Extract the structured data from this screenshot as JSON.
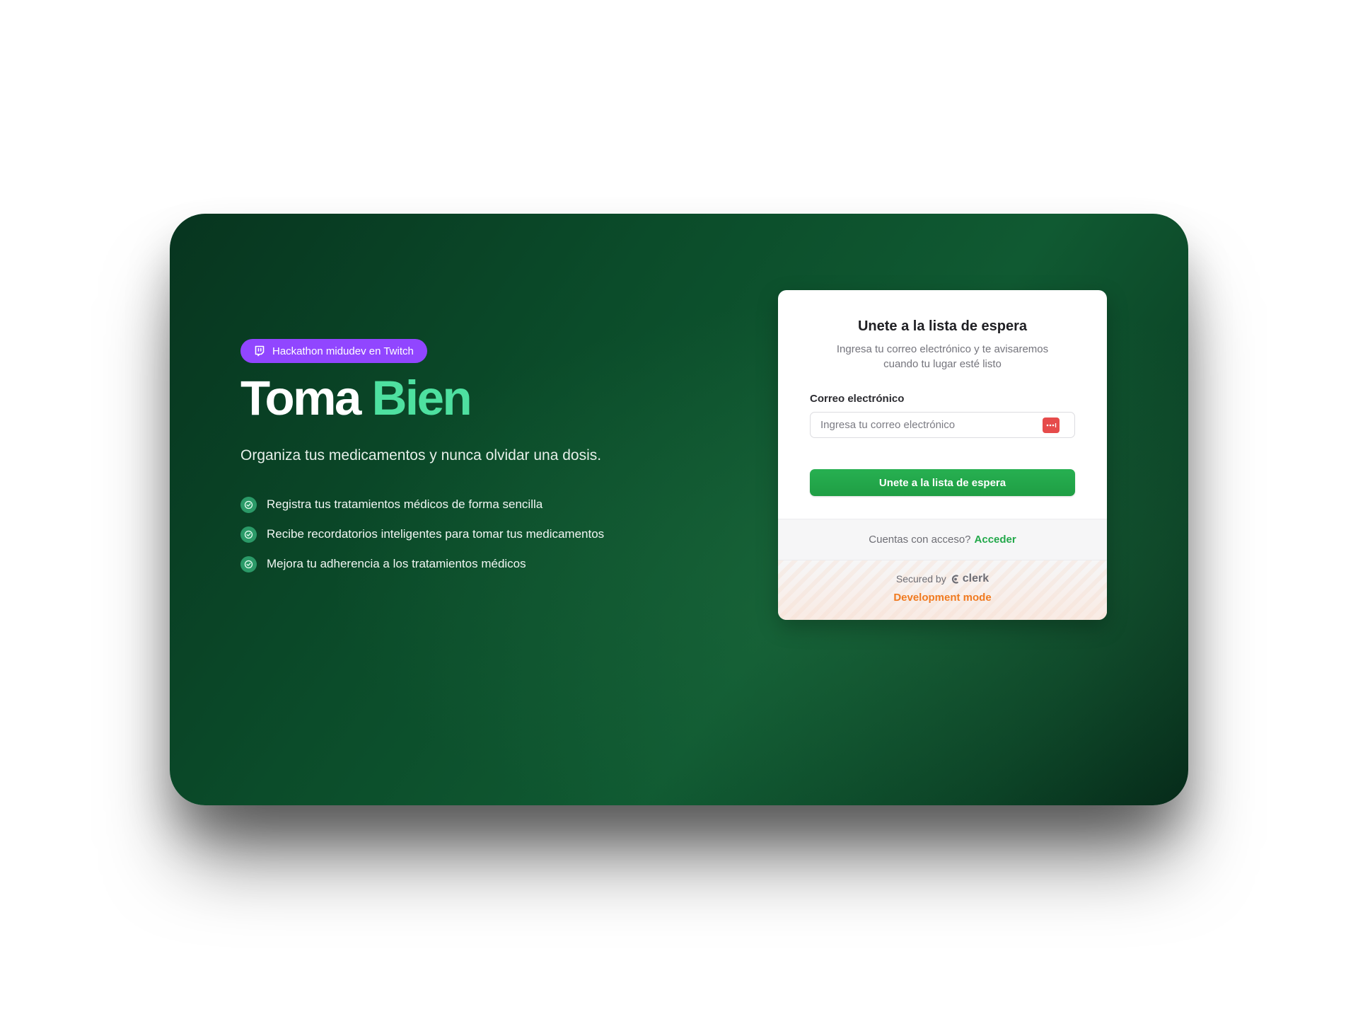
{
  "hero": {
    "badge": {
      "icon": "twitch-icon",
      "label": "Hackathon midudev en Twitch",
      "color": "#9146ff"
    },
    "title_part1": "Toma",
    "title_part2": "Bien",
    "title_accent_color": "#4ee0a0",
    "subtitle": "Organiza tus medicamentos y nunca olvidar una dosis.",
    "features": [
      {
        "icon": "check-circle-icon",
        "label": "Registra tus tratamientos médicos de forma sencilla"
      },
      {
        "icon": "check-circle-icon",
        "label": "Recibe recordatorios inteligentes para tomar tus medicamentos"
      },
      {
        "icon": "check-circle-icon",
        "label": "Mejora tu adherencia a los tratamientos médicos"
      }
    ]
  },
  "waitlist_card": {
    "title": "Unete a la lista de espera",
    "description": "Ingresa tu correo electrónico y te avisaremos cuando tu lugar esté listo",
    "email_label": "Correo electrónico",
    "email_value": "",
    "email_placeholder": "Ingresa tu correo electrónico",
    "password_manager_icon": "password-manager-icon",
    "submit_label": "Unete a la lista de espera",
    "submit_color": "#22a84a",
    "footer_prompt": "Cuentas con acceso?",
    "footer_link": "Acceder",
    "secured_by": "Secured by",
    "secured_brand": "clerk",
    "dev_mode": "Development mode",
    "dev_mode_color": "#f07a20"
  }
}
